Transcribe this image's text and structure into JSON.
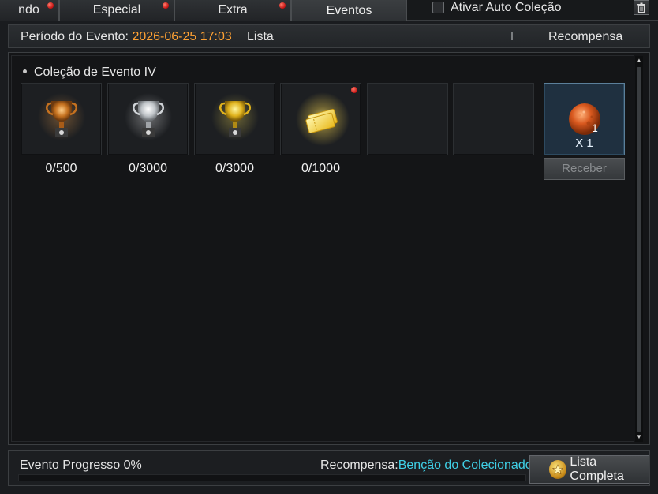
{
  "tabs": [
    {
      "label": "ndo",
      "active": false,
      "has_dot": true
    },
    {
      "label": "Especial",
      "active": false,
      "has_dot": true
    },
    {
      "label": "Extra",
      "active": false,
      "has_dot": true
    },
    {
      "label": "Eventos",
      "active": true,
      "has_dot": false
    }
  ],
  "auto_collect": {
    "label": "Ativar Auto Coleção",
    "checked": false
  },
  "trash_icon": "trash-icon",
  "info": {
    "period_label": "Período do Evento: ",
    "period_value": "2026-06-25 17:03",
    "list_label": "Lista",
    "reward_label": "Recompensa"
  },
  "section_title": "Coleção de Evento IV",
  "slots": [
    {
      "icon": "bronze-trophy-icon",
      "count": "0/500",
      "has_dot": false
    },
    {
      "icon": "silver-trophy-icon",
      "count": "0/3000",
      "has_dot": false
    },
    {
      "icon": "gold-trophy-icon",
      "count": "0/3000",
      "has_dot": false
    },
    {
      "icon": "golden-ticket-icon",
      "count": "0/1000",
      "has_dot": true
    },
    {
      "icon": "",
      "count": "",
      "has_dot": false
    },
    {
      "icon": "",
      "count": "",
      "has_dot": false
    }
  ],
  "reward": {
    "icon": "orange-orb-icon",
    "qty": "1",
    "x_label": "X 1",
    "receive_label": "Receber"
  },
  "bottom": {
    "progress_label": "Evento Progresso 0%",
    "progress": 0,
    "reward_prefix": "Recompensa:",
    "reward_name": "Benção do Colecionador",
    "full_list_label": "Lista Completa"
  },
  "colors": {
    "accent_orange": "#ffa133",
    "accent_cyan": "#3fd0e6",
    "notification_red": "#c21010"
  }
}
